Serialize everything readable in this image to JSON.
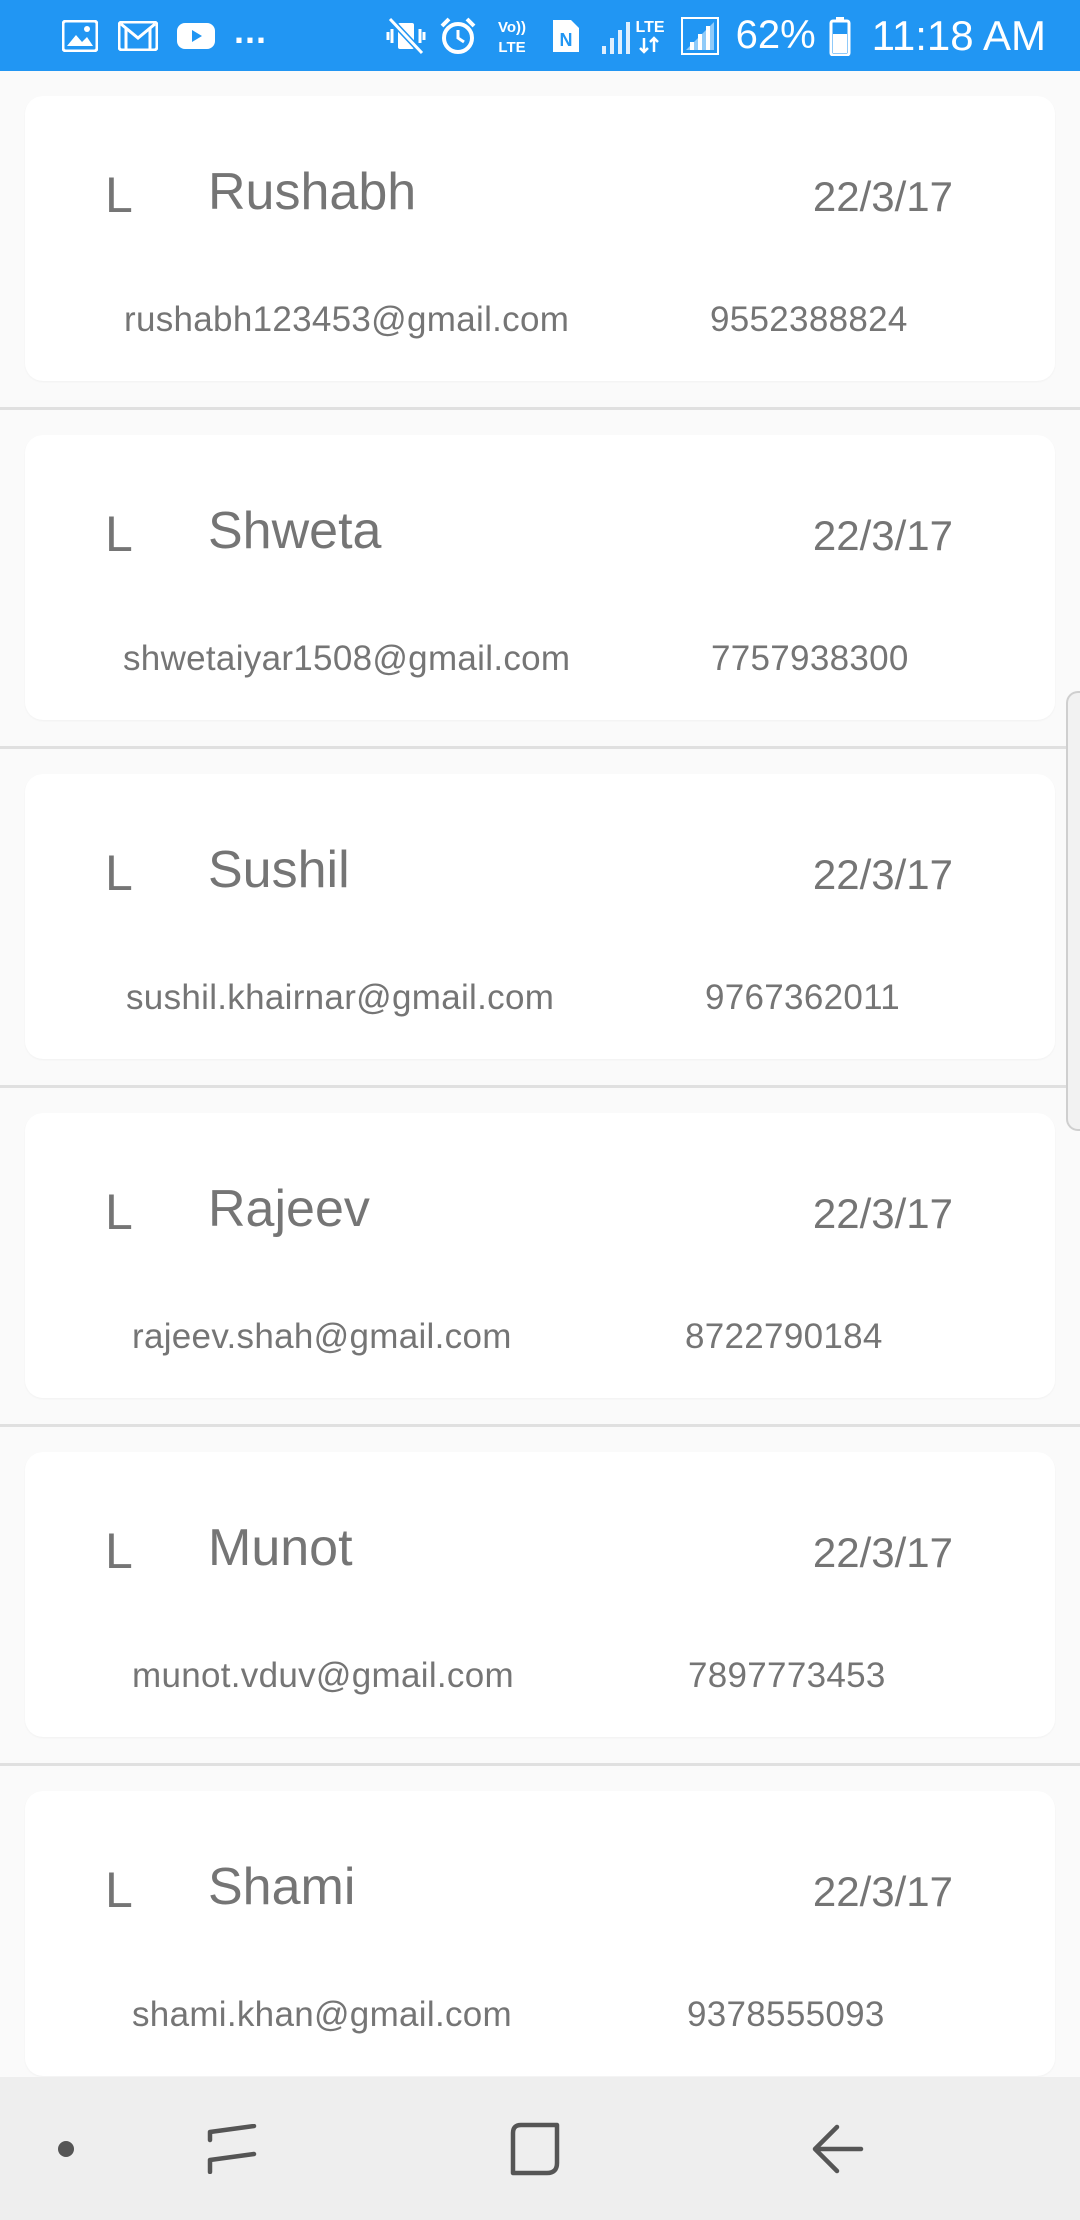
{
  "status_bar": {
    "left_icons": [
      "gallery-icon",
      "gmail-icon",
      "youtube-icon"
    ],
    "overflow_dots": "...",
    "right_icons": [
      "mute-vibrate-icon",
      "alarm-icon",
      "volte-icon",
      "nfc-icon",
      "signal-lte-icon",
      "signal-icon"
    ],
    "volte_label": "Vo)) LTE",
    "lte_label": "LTE",
    "battery_percent": "62%",
    "time": "11:18 AM",
    "background_color": "#2196f3"
  },
  "contacts": [
    {
      "initial": "L",
      "name": "Rushabh",
      "date": "22/3/17",
      "email": "rushabh123453@gmail.com",
      "phone": "9552388824"
    },
    {
      "initial": "L",
      "name": "Shweta",
      "date": "22/3/17",
      "email": "shwetaiyar1508@gmail.com",
      "phone": "7757938300"
    },
    {
      "initial": "L",
      "name": "Sushil",
      "date": "22/3/17",
      "email": "sushil.khairnar@gmail.com",
      "phone": "9767362011"
    },
    {
      "initial": "L",
      "name": "Rajeev",
      "date": "22/3/17",
      "email": "rajeev.shah@gmail.com",
      "phone": "8722790184"
    },
    {
      "initial": "L",
      "name": "Munot",
      "date": "22/3/17",
      "email": "munot.vduv@gmail.com",
      "phone": "7897773453"
    },
    {
      "initial": "L",
      "name": "Shami",
      "date": "22/3/17",
      "email": "shami.khan@gmail.com",
      "phone": "9378555093"
    }
  ],
  "nav_bar": {
    "buttons": [
      "dot-icon",
      "recents-icon",
      "home-icon",
      "back-icon"
    ]
  }
}
